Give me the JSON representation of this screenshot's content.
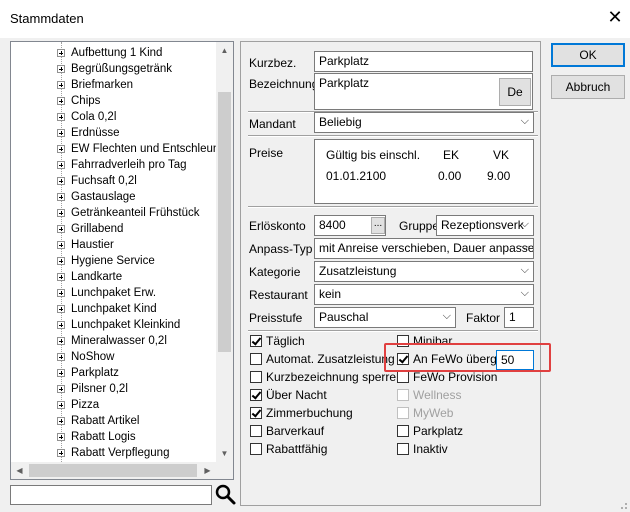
{
  "window": {
    "title": "Stammdaten",
    "close_glyph": "✕"
  },
  "tree": {
    "items": [
      "Aufbettung 1 Kind",
      "Begrüßungsgetränk",
      "Briefmarken",
      "Chips",
      "Cola 0,2l",
      "Erdnüsse",
      "EW Flechten und Entschleuni",
      "Fahrradverleih pro Tag",
      "Fuchsaft 0,2l",
      "Gastauslage",
      "Getränkeanteil Frühstück",
      "Grillabend",
      "Haustier",
      "Hygiene Service",
      "Landkarte",
      "Lunchpaket Erw.",
      "Lunchpaket Kind",
      "Lunchpaket Kleinkind",
      "Mineralwasser 0,2l",
      "NoShow",
      "Parkplatz",
      "Pilsner 0,2l",
      "Pizza",
      "Rabatt Artikel",
      "Rabatt Logis",
      "Rabatt Verpflegung"
    ]
  },
  "search": {
    "value": ""
  },
  "form": {
    "kurzbez_label": "Kurzbez.",
    "kurzbez_value": "Parkplatz",
    "bezeichnung_label": "Bezeichnung",
    "bezeichnung_value": "Parkplatz",
    "lang_button": "De",
    "mandant_label": "Mandant",
    "mandant_value": "Beliebig",
    "preise_label": "Preise",
    "preise_headers": [
      "Gültig bis einschl.",
      "EK",
      "VK"
    ],
    "preise_rows": [
      [
        "01.01.2100",
        "0.00",
        "9.00"
      ]
    ],
    "erloeskonto_label": "Erlöskonto",
    "erloeskonto_value": "8400",
    "ellipsis": "...",
    "gruppe_label": "Gruppe",
    "gruppe_value": "Rezeptionsverk",
    "anpasstyp_label": "Anpass-Typ",
    "anpasstyp_value": "mit Anreise verschieben, Dauer anpassen",
    "kategorie_label": "Kategorie",
    "kategorie_value": "Zusatzleistung",
    "restaurant_label": "Restaurant",
    "restaurant_value": "kein",
    "preisstufe_label": "Preisstufe",
    "preisstufe_value": "Pauschal",
    "faktor_label": "Faktor",
    "faktor_value": "1"
  },
  "checkboxes_left": [
    {
      "label": "Täglich",
      "checked": true
    },
    {
      "label": "Automat. Zusatzleistung",
      "checked": false
    },
    {
      "label": "Kurzbezeichnung sperren",
      "checked": false
    },
    {
      "label": "Über Nacht",
      "checked": true
    },
    {
      "label": "Zimmerbuchung",
      "checked": true
    },
    {
      "label": "Barverkauf",
      "checked": false
    },
    {
      "label": "Rabattfähig",
      "checked": false
    }
  ],
  "checkboxes_right": [
    {
      "label": "Minibar",
      "checked": false,
      "disabled": false
    },
    {
      "label": "An FeWo überg.",
      "checked": true,
      "disabled": false
    },
    {
      "label": "FeWo Provision",
      "checked": false,
      "disabled": false
    },
    {
      "label": "Wellness",
      "checked": false,
      "disabled": true
    },
    {
      "label": "MyWeb",
      "checked": false,
      "disabled": true
    },
    {
      "label": "Parkplatz",
      "checked": false,
      "disabled": false
    },
    {
      "label": "Inaktiv",
      "checked": false,
      "disabled": false
    }
  ],
  "fewo_value": "50",
  "buttons": {
    "ok": "OK",
    "cancel": "Abbruch"
  },
  "colors": {
    "highlight": "#e04040",
    "focus_border": "#0078d7"
  }
}
